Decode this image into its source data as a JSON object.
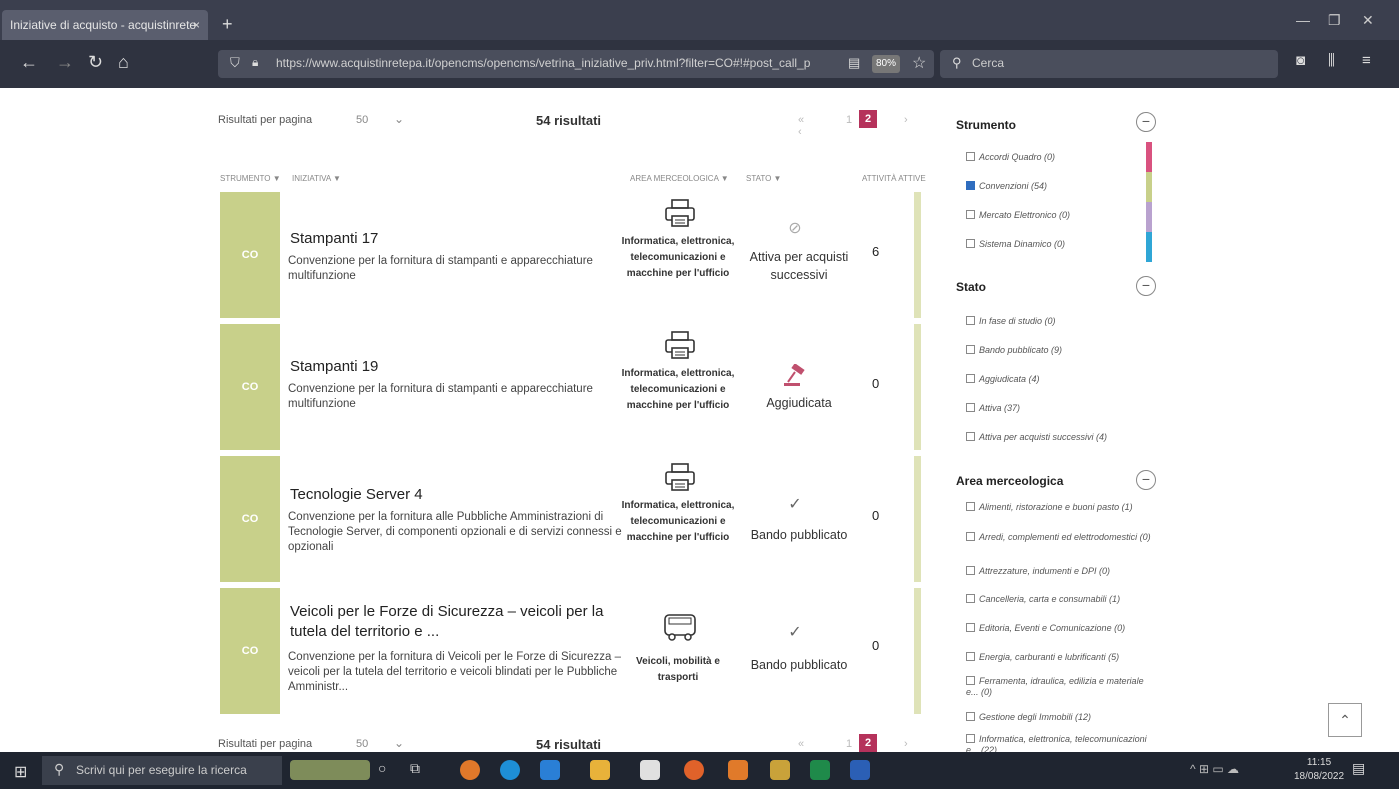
{
  "browser": {
    "tab_title": "Iniziative di acquisto - acquistinrete",
    "tab_close": "×",
    "new_tab": "+",
    "url": "https://www.acquistinretepa.it/opencms/opencms/vetrina_iniziative_priv.html?filter=CO#!#post_call_p",
    "zoom": "80%",
    "search_placeholder": "Cerca"
  },
  "pagination": {
    "per_page_label": "Risultati per pagina",
    "per_page_value": "50",
    "results_count": "54 risultati",
    "page_1": "1",
    "page_2": "2"
  },
  "columns": {
    "strumento": "STRUMENTO ▼",
    "iniziativa": "INIZIATIVA ▼",
    "area": "AREA MERCEOLOGICA ▼",
    "stato": "STATO ▼",
    "ordini": "ATTIVITÀ ATTIVE"
  },
  "initiatives": [
    {
      "badge": "CO",
      "title": "Stampanti 17",
      "description": "Convenzione per la fornitura di stampanti e apparecchiature multifunzione",
      "category": "Informatica, elettronica, telecomunicazioni e macchine per l'ufficio",
      "category_icon": "printer-icon",
      "status": "Attiva per acquisti successivi",
      "status_icon": "check-circle-icon",
      "count": "6"
    },
    {
      "badge": "CO",
      "title": "Stampanti 19",
      "description": "Convenzione per la fornitura di stampanti e apparecchiature multifunzione",
      "category": "Informatica, elettronica, telecomunicazioni e macchine per l'ufficio",
      "category_icon": "printer-icon",
      "status": "Aggiudicata",
      "status_icon": "gavel-icon",
      "count": "0"
    },
    {
      "badge": "CO",
      "title": "Tecnologie Server 4",
      "description": "Convenzione per la fornitura alle Pubbliche Amministrazioni di Tecnologie Server, di componenti opzionali e di servizi connessi e opzionali",
      "category": "Informatica, elettronica, telecomunicazioni e macchine per l'ufficio",
      "category_icon": "printer-icon",
      "status": "Bando pubblicato",
      "status_icon": "check-icon",
      "count": "0"
    },
    {
      "badge": "CO",
      "title": "Veicoli per le Forze di Sicurezza – veicoli per la tutela del territorio e ...",
      "description": "Convenzione per la fornitura di Veicoli per le Forze di Sicurezza – veicoli per la tutela del territorio e veicoli blindati per le Pubbliche Amministr...",
      "category": "Veicoli, mobilità e trasporti",
      "category_icon": "bus-icon",
      "status": "Bando pubblicato",
      "status_icon": "check-icon",
      "count": "0"
    }
  ],
  "sidebar": {
    "strumento": {
      "title": "Strumento",
      "items": [
        {
          "label": "Accordi Quadro (0)",
          "checked": false
        },
        {
          "label": "Convenzioni (54)",
          "checked": true
        },
        {
          "label": "Mercato Elettronico (0)",
          "checked": false
        },
        {
          "label": "Sistema Dinamico (0)",
          "checked": false
        }
      ],
      "colors": [
        "#d9527f",
        "#c8d08a",
        "#b9a2cf",
        "#2fa6d6"
      ]
    },
    "stato": {
      "title": "Stato",
      "items": [
        {
          "label": "In fase di studio (0)"
        },
        {
          "label": "Bando pubblicato (9)"
        },
        {
          "label": "Aggiudicata (4)"
        },
        {
          "label": "Attiva (37)"
        },
        {
          "label": "Attiva per acquisti successivi (4)"
        }
      ]
    },
    "area": {
      "title": "Area merceologica",
      "items": [
        {
          "label": "Alimenti, ristorazione e buoni pasto (1)"
        },
        {
          "label": "Arredi, complementi ed elettrodomestici (0)"
        },
        {
          "label": "Attrezzature, indumenti e DPI (0)"
        },
        {
          "label": "Cancelleria, carta e consumabili (1)"
        },
        {
          "label": "Editoria, Eventi e Comunicazione (0)"
        },
        {
          "label": "Energia, carburanti e lubrificanti (5)"
        },
        {
          "label": "Ferramenta, idraulica, edilizia e materiale e... (0)"
        },
        {
          "label": "Gestione degli Immobili (12)"
        },
        {
          "label": "Informatica, elettronica, telecomunicazioni e... (22)"
        }
      ]
    }
  },
  "taskbar": {
    "search_placeholder": "Scrivi qui per eseguire la ricerca",
    "time": "11:15",
    "date": "18/08/2022"
  }
}
